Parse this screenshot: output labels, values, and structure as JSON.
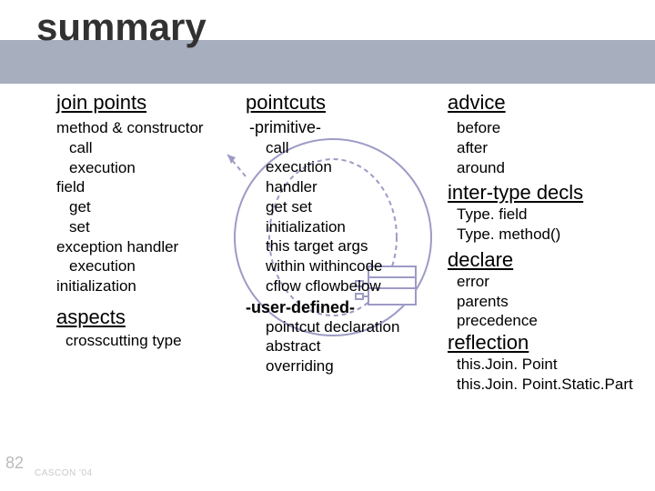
{
  "title": "summary",
  "page_number": "82",
  "footer": "CASCON '04",
  "col1": {
    "header": "join points",
    "items": [
      {
        "t": "method & constructor",
        "lv": 1
      },
      {
        "t": "call",
        "lv": 2
      },
      {
        "t": "execution",
        "lv": 2
      },
      {
        "t": "field",
        "lv": 1
      },
      {
        "t": "get",
        "lv": 2
      },
      {
        "t": "set",
        "lv": 2
      },
      {
        "t": "exception handler",
        "lv": 1
      },
      {
        "t": "execution",
        "lv": 2
      },
      {
        "t": "initialization",
        "lv": 1
      }
    ],
    "header2": "aspects",
    "items2": [
      {
        "t": "crosscutting type"
      }
    ]
  },
  "col2": {
    "header": "pointcuts",
    "primitive_label": "-primitive-",
    "primitive_items": [
      "call",
      "execution",
      "handler",
      "get  set",
      "initialization",
      "this  target args",
      "within withincode",
      "cflow cflowbelow"
    ],
    "userdef_label": "-user-defined-",
    "userdef_items": [
      "pointcut declaration",
      "abstract",
      "overriding"
    ]
  },
  "col3": {
    "header": "advice",
    "advice_items": [
      "before",
      "after",
      "around"
    ],
    "intertype_header": "inter-type decls",
    "intertype_items": [
      "Type. field",
      "Type. method()"
    ],
    "declare_header": "declare",
    "declare_items": [
      "error",
      "parents",
      "precedence"
    ],
    "reflection_header": "reflection",
    "reflection_items": [
      "this.Join. Point",
      "this.Join. Point.Static.Part"
    ]
  }
}
